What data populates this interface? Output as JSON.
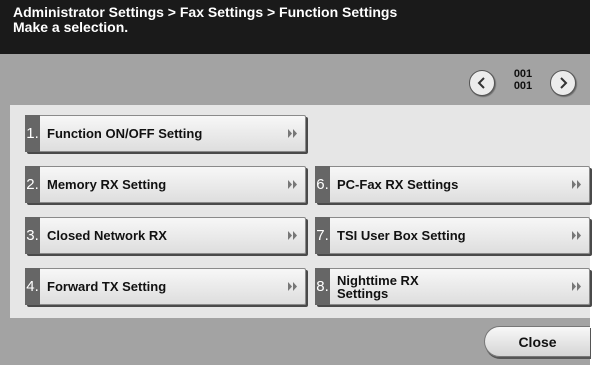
{
  "header": {
    "breadcrumb": "Administrator Settings > Fax Settings > Function Settings",
    "instruction": "Make a selection."
  },
  "pager": {
    "current": "001",
    "total": "001"
  },
  "functions": [
    {
      "number": "1.",
      "label": "Function ON/OFF Setting"
    },
    {
      "number": "2.",
      "label": "Memory RX Setting"
    },
    {
      "number": "3.",
      "label": "Closed Network RX"
    },
    {
      "number": "4.",
      "label": "Forward TX Setting"
    },
    {
      "number": "6.",
      "label": "PC-Fax RX Settings"
    },
    {
      "number": "7.",
      "label": "TSI User Box Setting"
    },
    {
      "number": "8.",
      "label": "Nighttime RX Settings"
    }
  ],
  "footer": {
    "close_label": "Close"
  },
  "icons": {
    "prev": "chevron-left-icon",
    "next": "chevron-right-icon",
    "item_arrow": "double-chevron-right-icon"
  },
  "colors": {
    "header_bg": "#1a1a1a",
    "panel_bg": "#a3a3a3",
    "number_tab": "#666666"
  }
}
